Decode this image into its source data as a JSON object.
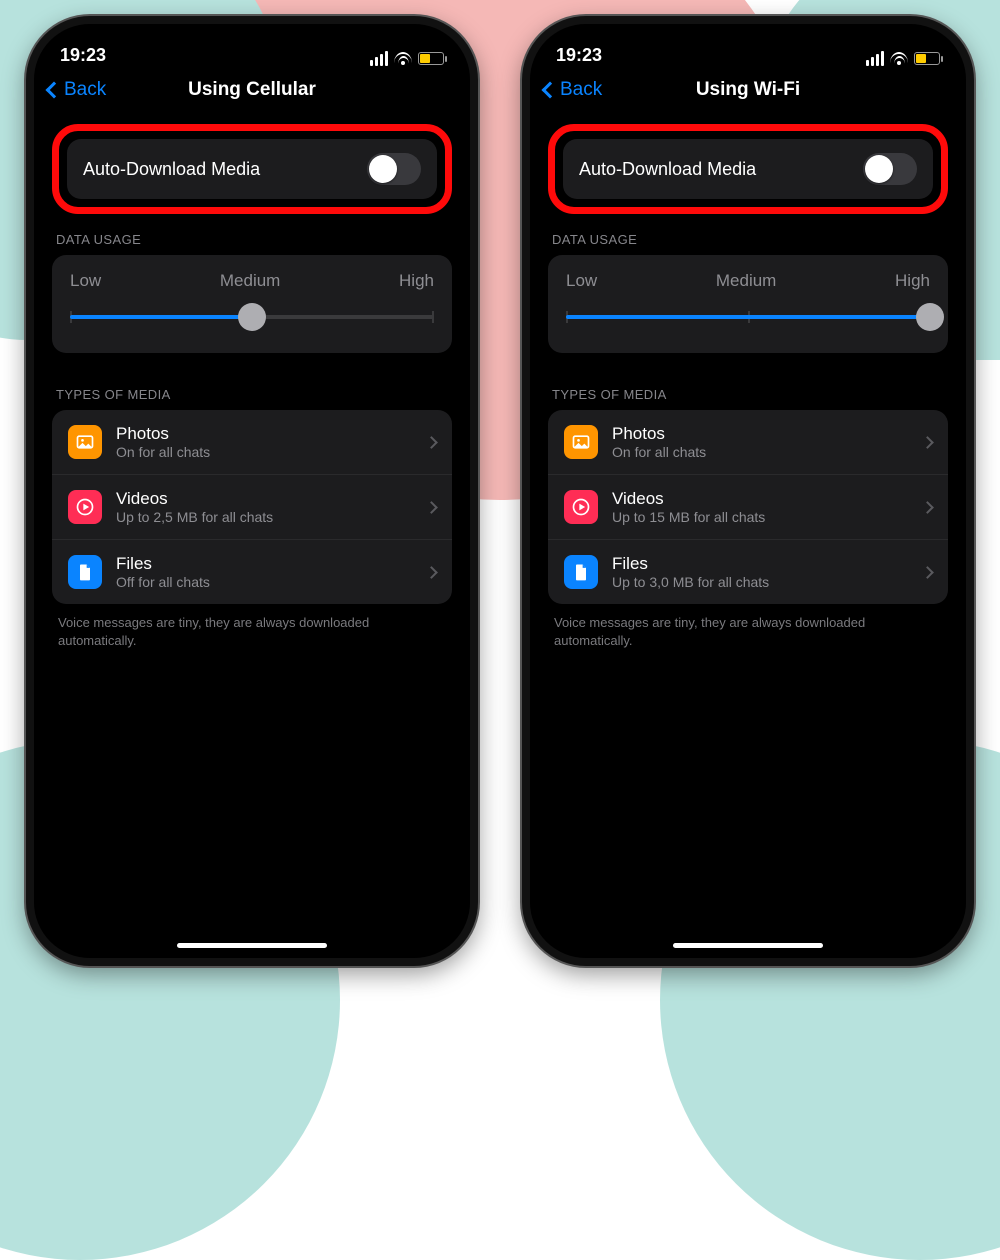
{
  "phones": [
    {
      "status": {
        "time": "19:23",
        "battery_pct": 35
      },
      "nav": {
        "back": "Back",
        "title": "Using Cellular"
      },
      "auto_download": {
        "label": "Auto-Download Media",
        "on": false
      },
      "data_usage": {
        "header": "DATA USAGE",
        "low": "Low",
        "medium": "Medium",
        "high": "High",
        "value_pct": 50
      },
      "types_header": "TYPES OF MEDIA",
      "media": [
        {
          "icon": "photos",
          "title": "Photos",
          "subtitle": "On for all chats"
        },
        {
          "icon": "videos",
          "title": "Videos",
          "subtitle": "Up to 2,5 MB for all chats"
        },
        {
          "icon": "files",
          "title": "Files",
          "subtitle": "Off for all chats"
        }
      ],
      "footnote": "Voice messages are tiny, they are always downloaded automatically."
    },
    {
      "status": {
        "time": "19:23",
        "battery_pct": 35
      },
      "nav": {
        "back": "Back",
        "title": "Using Wi-Fi"
      },
      "auto_download": {
        "label": "Auto-Download Media",
        "on": false
      },
      "data_usage": {
        "header": "DATA USAGE",
        "low": "Low",
        "medium": "Medium",
        "high": "High",
        "value_pct": 100
      },
      "types_header": "TYPES OF MEDIA",
      "media": [
        {
          "icon": "photos",
          "title": "Photos",
          "subtitle": "On for all chats"
        },
        {
          "icon": "videos",
          "title": "Videos",
          "subtitle": "Up to 15 MB for all chats"
        },
        {
          "icon": "files",
          "title": "Files",
          "subtitle": "Up to 3,0 MB for all chats"
        }
      ],
      "footnote": "Voice messages are tiny, they are always downloaded automatically."
    }
  ]
}
